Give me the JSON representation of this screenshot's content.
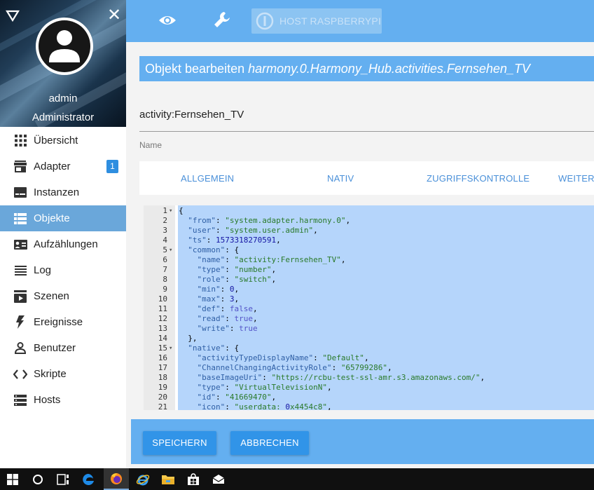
{
  "sidebar": {
    "user": "admin",
    "role": "Administrator",
    "items": [
      {
        "label": "Übersicht",
        "icon": "grid-icon"
      },
      {
        "label": "Adapter",
        "icon": "store-icon",
        "badge": "1"
      },
      {
        "label": "Instanzen",
        "icon": "instances-icon"
      },
      {
        "label": "Objekte",
        "icon": "list-icon",
        "active": true
      },
      {
        "label": "Aufzählungen",
        "icon": "enum-icon"
      },
      {
        "label": "Log",
        "icon": "log-icon"
      },
      {
        "label": "Szenen",
        "icon": "scenes-icon"
      },
      {
        "label": "Ereignisse",
        "icon": "lightning-icon"
      },
      {
        "label": "Benutzer",
        "icon": "user-icon"
      },
      {
        "label": "Skripte",
        "icon": "code-icon"
      },
      {
        "label": "Hosts",
        "icon": "hosts-icon"
      }
    ]
  },
  "topbar": {
    "host_label": "HOST RASPBERRYPI"
  },
  "dialog": {
    "title_prefix": "Objekt bearbeiten",
    "object_id": "harmony.0.Harmony_Hub.activities.Fernsehen_TV",
    "name_value": "activity:Fernsehen_TV",
    "name_label": "Name",
    "tabs": [
      "ALLGEMEIN",
      "NATIV",
      "ZUGRIFFSKONTROLLE",
      "WEITERE"
    ],
    "save_label": "SPEICHERN",
    "cancel_label": "ABBRECHEN"
  },
  "editor": {
    "lines": [
      {
        "n": "1",
        "fold": true,
        "text": "{"
      },
      {
        "n": "2",
        "text": "  \"from\": \"system.adapter.harmony.0\","
      },
      {
        "n": "3",
        "text": "  \"user\": \"system.user.admin\","
      },
      {
        "n": "4",
        "text": "  \"ts\": 1573318270591,"
      },
      {
        "n": "5",
        "fold": true,
        "text": "  \"common\": {"
      },
      {
        "n": "6",
        "text": "    \"name\": \"activity:Fernsehen_TV\","
      },
      {
        "n": "7",
        "text": "    \"type\": \"number\","
      },
      {
        "n": "8",
        "text": "    \"role\": \"switch\","
      },
      {
        "n": "9",
        "text": "    \"min\": 0,"
      },
      {
        "n": "10",
        "text": "    \"max\": 3,"
      },
      {
        "n": "11",
        "text": "    \"def\": false,"
      },
      {
        "n": "12",
        "text": "    \"read\": true,"
      },
      {
        "n": "13",
        "text": "    \"write\": true"
      },
      {
        "n": "14",
        "text": "  },"
      },
      {
        "n": "15",
        "fold": true,
        "text": "  \"native\": {"
      },
      {
        "n": "16",
        "text": "    \"activityTypeDisplayName\": \"Default\","
      },
      {
        "n": "17",
        "text": "    \"ChannelChangingActivityRole\": \"65799286\","
      },
      {
        "n": "18",
        "text": "    \"baseImageUri\": \"https://rcbu-test-ssl-amr.s3.amazonaws.com/\","
      },
      {
        "n": "19",
        "text": "    \"type\": \"VirtualTelevisionN\","
      },
      {
        "n": "20",
        "text": "    \"id\": \"41669470\","
      },
      {
        "n": "21",
        "text": "    \"icon\": \"userdata: 0x4454c8\","
      }
    ]
  },
  "colors": {
    "accent": "#64aff0",
    "active_menu": "#6aa7da",
    "button": "#3194e8",
    "selection": "#b5d5fb"
  },
  "taskbar": {
    "icons": [
      "windows-start-icon",
      "search-icon",
      "task-view-icon",
      "edge-icon",
      "firefox-icon",
      "ie-icon",
      "file-explorer-icon",
      "store-icon",
      "mail-icon"
    ]
  }
}
